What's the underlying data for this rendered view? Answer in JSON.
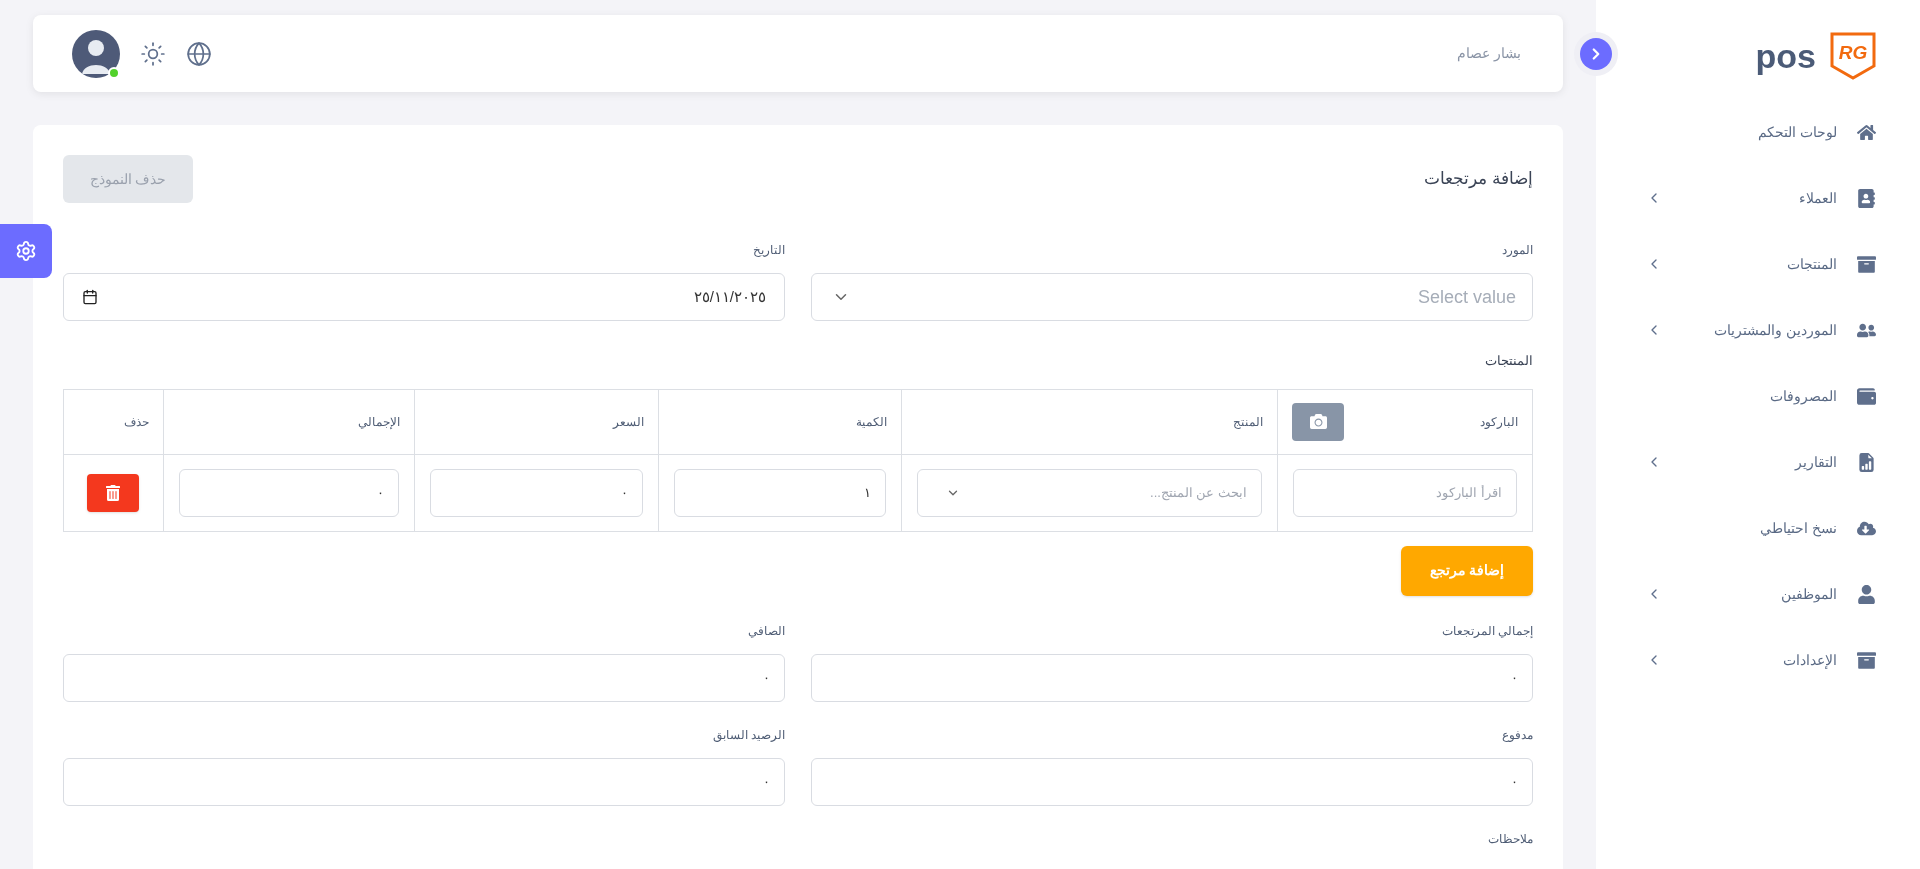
{
  "sidebar": {
    "brand": "pos",
    "logo_mark": "RG",
    "items": [
      {
        "label": "لوحات التحكم",
        "expandable": false
      },
      {
        "label": "العملاء",
        "expandable": true
      },
      {
        "label": "المنتجات",
        "expandable": true
      },
      {
        "label": "الموردين والمشتريات",
        "expandable": true
      },
      {
        "label": "المصروفات",
        "expandable": false
      },
      {
        "label": "التقارير",
        "expandable": true
      },
      {
        "label": "نسخ احتياطي",
        "expandable": false
      },
      {
        "label": "الموظفين",
        "expandable": true
      },
      {
        "label": "الإعدادات",
        "expandable": true
      }
    ]
  },
  "topbar": {
    "user_name": "بشار عصام",
    "online": true
  },
  "form": {
    "title": "إضافة مرتجعات",
    "delete_button": {
      "label": "حذف النموذج",
      "disabled": true
    },
    "supplier": {
      "label": "المورد",
      "placeholder": "Select value"
    },
    "date": {
      "label": "التاريخ",
      "value": "٢٥/١١/٢٠٢٥"
    },
    "products_label": "المنتجات",
    "table": {
      "columns": [
        "الباركود",
        "المنتج",
        "الكمية",
        "السعر",
        "الإجمالي",
        "حذف"
      ],
      "rows": [
        {
          "barcode_placeholder": "اقرأ الباركود",
          "product_placeholder": "ابحث عن المنتج...",
          "quantity": "١",
          "price": "٠",
          "total": "٠"
        }
      ]
    },
    "add_button": "إضافة مرتجع",
    "summary": [
      {
        "label": "إجمالي المرتجعات",
        "value": "٠"
      },
      {
        "label": "الصافي",
        "value": "٠"
      },
      {
        "label": "مدفوع",
        "value": "٠"
      },
      {
        "label": "الرصيد السابق",
        "value": "٠"
      }
    ],
    "notes_label": "ملاحظات"
  }
}
